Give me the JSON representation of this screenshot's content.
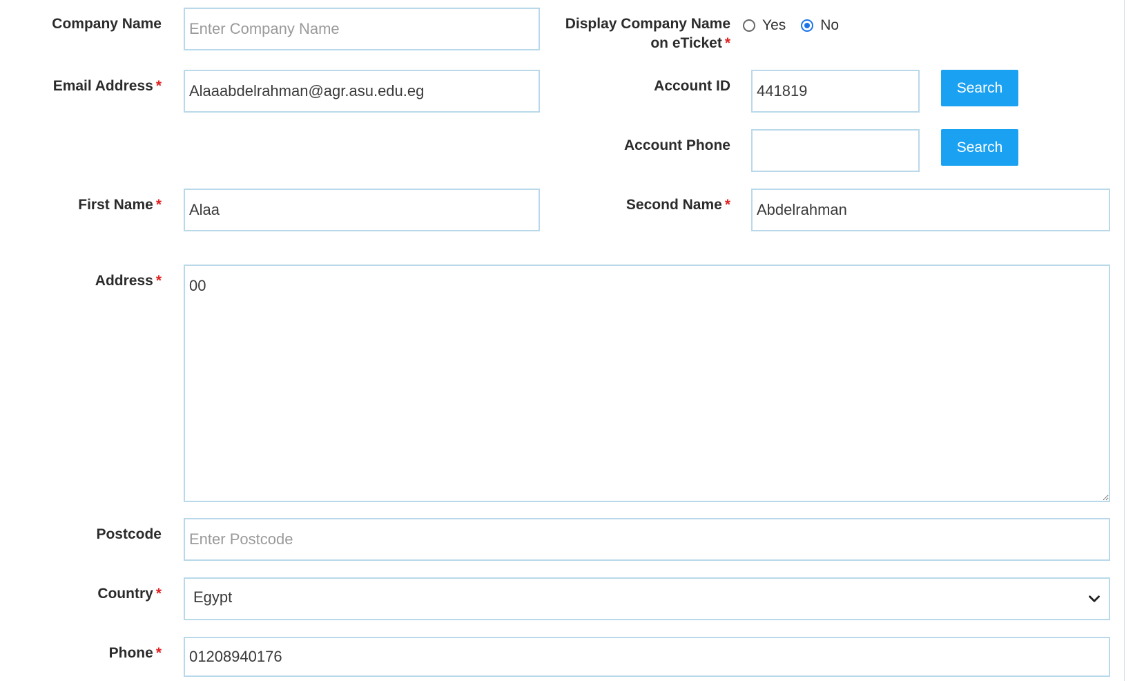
{
  "form": {
    "company_name": {
      "label": "Company Name",
      "placeholder": "Enter Company Name",
      "value": ""
    },
    "display_company": {
      "label_line1": "Display Company Name",
      "label_line2": "on eTicket",
      "options": [
        "Yes",
        "No"
      ],
      "selected": "No"
    },
    "email": {
      "label": "Email Address",
      "value": "Alaaabdelrahman@agr.asu.edu.eg"
    },
    "account_id": {
      "label": "Account ID",
      "value": "441819",
      "button": "Search"
    },
    "account_phone": {
      "label": "Account Phone",
      "value": "",
      "button": "Search"
    },
    "first_name": {
      "label": "First Name",
      "value": "Alaa"
    },
    "second_name": {
      "label": "Second Name",
      "value": "Abdelrahman"
    },
    "address": {
      "label": "Address",
      "value": "00"
    },
    "postcode": {
      "label": "Postcode",
      "placeholder": "Enter Postcode",
      "value": ""
    },
    "country": {
      "label": "Country",
      "value": "Egypt"
    },
    "phone": {
      "label": "Phone",
      "value": "01208940176"
    },
    "required_mark": "*"
  },
  "colors": {
    "accent": "#1ba1f2",
    "border": "#b9d9ea",
    "required": "#e02020"
  }
}
